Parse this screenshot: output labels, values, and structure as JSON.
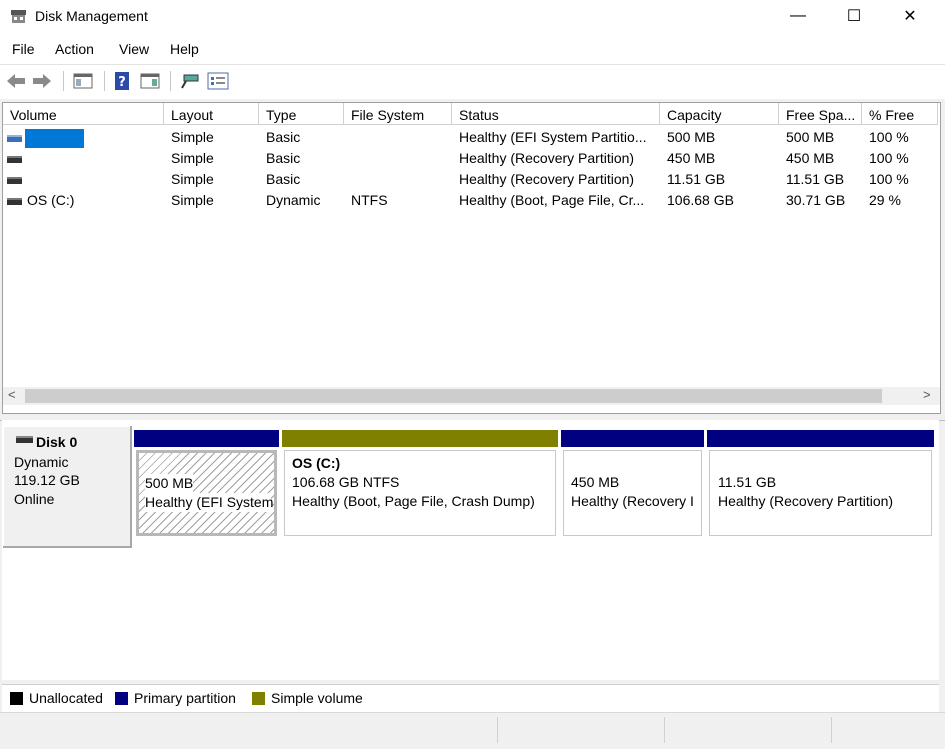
{
  "window": {
    "title": "Disk Management",
    "minimize": "—",
    "maximize": "☐",
    "close": "✕"
  },
  "menu": [
    "File",
    "Action",
    "View",
    "Help"
  ],
  "toolbar": [
    "back-icon",
    "forward-icon",
    "console-tree-icon",
    "help-icon",
    "show-pane-icon",
    "connect-icon",
    "properties-icon"
  ],
  "columns": [
    "Volume",
    "Layout",
    "Type",
    "File System",
    "Status",
    "Capacity",
    "Free Spa...",
    "% Free"
  ],
  "volumes": [
    {
      "volume": "",
      "layout": "Simple",
      "type": "Basic",
      "fs": "",
      "status": "Healthy (EFI System Partitio...",
      "capacity": "500 MB",
      "free": "500 MB",
      "pct": "100 %"
    },
    {
      "volume": "",
      "layout": "Simple",
      "type": "Basic",
      "fs": "",
      "status": "Healthy (Recovery Partition)",
      "capacity": "450 MB",
      "free": "450 MB",
      "pct": "100 %"
    },
    {
      "volume": "",
      "layout": "Simple",
      "type": "Basic",
      "fs": "",
      "status": "Healthy (Recovery Partition)",
      "capacity": "11.51 GB",
      "free": "11.51 GB",
      "pct": "100 %"
    },
    {
      "volume": "OS (C:)",
      "layout": "Simple",
      "type": "Dynamic",
      "fs": "NTFS",
      "status": "Healthy (Boot, Page File, Cr...",
      "capacity": "106.68 GB",
      "free": "30.71 GB",
      "pct": "29 %"
    }
  ],
  "scroll": {
    "left": "<",
    "right": ">"
  },
  "disk": {
    "name": "Disk 0",
    "type": "Dynamic",
    "size": "119.12 GB",
    "state": "Online"
  },
  "partitions": [
    {
      "name": "",
      "size": "500 MB",
      "status": "Healthy (EFI System",
      "color": "#000080"
    },
    {
      "name": "OS  (C:)",
      "size": "106.68 GB NTFS",
      "status": "Healthy (Boot, Page File, Crash Dump)",
      "color": "#808000"
    },
    {
      "name": "",
      "size": "450 MB",
      "status": "Healthy (Recovery I",
      "color": "#000080"
    },
    {
      "name": "",
      "size": "11.51 GB",
      "status": "Healthy (Recovery Partition)",
      "color": "#000080"
    }
  ],
  "legend": [
    {
      "label": "Unallocated",
      "color": "#000000"
    },
    {
      "label": "Primary partition",
      "color": "#000080"
    },
    {
      "label": "Simple volume",
      "color": "#808000"
    }
  ]
}
